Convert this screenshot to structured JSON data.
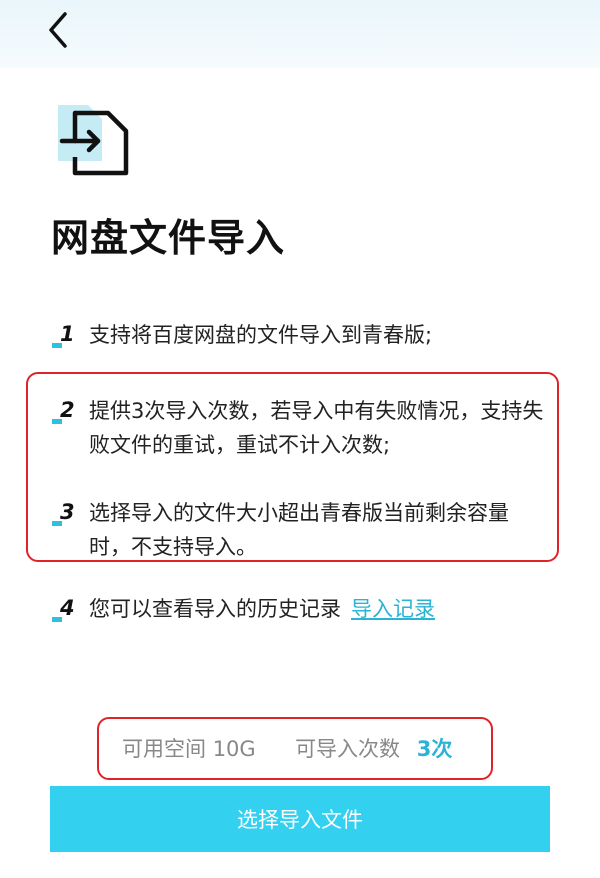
{
  "header": {
    "back_icon": "chevron-left-icon"
  },
  "hero": {
    "icon": "file-import-icon",
    "accent_color": "#c5ecf5",
    "title": "网盘文件导入"
  },
  "items": [
    {
      "number": "1",
      "text": "支持将百度网盘的文件导入到青春版;"
    },
    {
      "number": "2",
      "text": "提供3次导入次数，若导入中有失败情况，支持失败文件的重试，重试不计入次数;"
    },
    {
      "number": "3",
      "text": "选择导入的文件大小超出青春版当前剩余容量时，不支持导入。"
    },
    {
      "number": "4",
      "text": "您可以查看导入的历史记录",
      "link": "导入记录"
    }
  ],
  "quota": {
    "space_label": "可用空间",
    "space_value": "10G",
    "count_label": "可导入次数",
    "count_value": "3次"
  },
  "cta": {
    "label": "选择导入文件"
  },
  "colors": {
    "accent": "#2bb3d6",
    "button": "#33d0f0",
    "highlight_box": "#e0222a",
    "number_marker": "#2cc1de"
  }
}
